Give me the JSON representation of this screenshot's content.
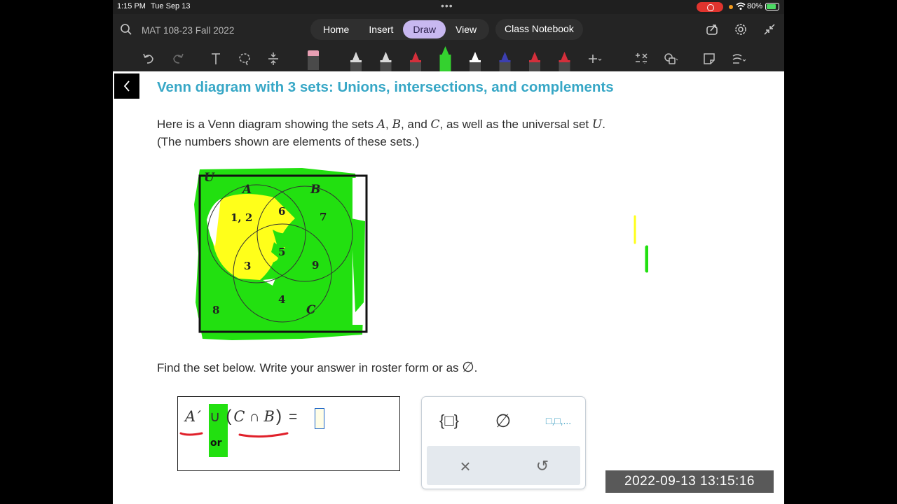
{
  "status": {
    "time": "1:15 PM",
    "date": "Tue Sep 13",
    "dots": "•••",
    "battery": "80%"
  },
  "toolbar": {
    "notebook_title": "MAT 108-23 Fall 2022",
    "tabs": [
      {
        "label": "Home"
      },
      {
        "label": "Insert"
      },
      {
        "label": "Draw"
      },
      {
        "label": "View"
      }
    ],
    "active_tab": "Draw",
    "class_notebook": "Class Notebook",
    "pen_colors": [
      "#d9d9d9",
      "#d9d9d9",
      "#d42f3b",
      "#34d12f",
      "#ffffff",
      "#3c3fb0",
      "#d42f3b",
      "#d42f3b"
    ],
    "accent": "#c8b8f0"
  },
  "content": {
    "title": "Venn diagram with 3 sets: Unions, intersections, and complements",
    "intro_1a": "Here is a Venn diagram showing the sets ",
    "set_a": "A",
    "set_b": "B",
    "set_c": "C",
    "set_u": "U",
    "comma": ", ",
    "and_text": ", and ",
    "intro_1b": ", as well as the universal set ",
    "period": ".",
    "intro_2": "(The numbers shown are elements of these sets.)",
    "find_text": "Find the set below. Write your answer in roster form or as ",
    "empty_set": "∅",
    "title_color": "#37a7c6"
  },
  "venn": {
    "labels": {
      "u": "U",
      "a": "A",
      "b": "B",
      "c": "C"
    },
    "regions": {
      "a_only": "1, 2",
      "ab_only": "6",
      "b_only": "7",
      "abc": "5",
      "ac_only": "3",
      "bc_only": "9",
      "c_only": "4",
      "outside": "8"
    },
    "highlight_green": "#22e010",
    "highlight_yellow": "#ffff1a"
  },
  "answer": {
    "a": "A",
    "prime": "′",
    "union": "∪",
    "open_paren": "(",
    "c": "C",
    "intersect": "∩",
    "b": "B",
    "close_paren": ")",
    "equals": "=",
    "input_value": ""
  },
  "keypad": {
    "set_braces": "{□}",
    "empty_set": "∅",
    "list": "□,□,...",
    "clear": "×",
    "undo": "↺"
  },
  "timestamp": "2022-09-13 13:15:16"
}
